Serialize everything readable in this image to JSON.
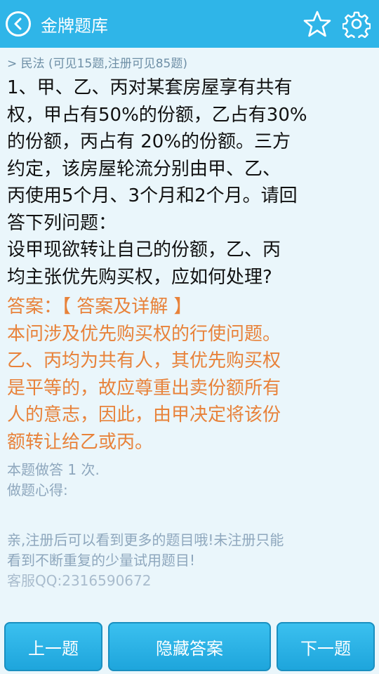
{
  "header": {
    "title": "金牌题库"
  },
  "breadcrumb": "> 民法 (可见15题,注册可见85题)",
  "question": {
    "lines": [
      "1、甲、乙、丙对某套房屋享有共有",
      "权，甲占有50%的份额，乙占有30%",
      "的份额，丙占有 20%的份额。三方",
      "约定，该房屋轮流分别由甲、乙、",
      "丙使用5个月、3个月和2个月。请回",
      "答下列问题：",
      "设甲现欲转让自己的份额，乙、丙",
      "均主张优先购买权，应如何处理?"
    ]
  },
  "answer": {
    "title": "答案：【 答案及详解 】",
    "lines": [
      "本问涉及优先购买权的行使问题。",
      "乙、丙均为共有人，其优先购买权",
      "是平等的，故应尊重出卖份额所有",
      "人的意志，因此，由甲决定将该份",
      "额转让给乙或丙。"
    ]
  },
  "meta": {
    "answered": "本题做答 1 次.",
    "notes_label": "做题心得:"
  },
  "notice": {
    "line1": "亲,注册后可以看到更多的题目哦!未注册只能",
    "line2": "看到不断重复的少量试用题目!",
    "service": "客服QQ:2316590672"
  },
  "buttons": {
    "prev": "上一题",
    "hide_answer": "隐藏答案",
    "next": "下一题"
  },
  "icons": {
    "back": "back-circle-icon",
    "favorite": "star-icon",
    "settings": "gear-icon"
  },
  "colors": {
    "primary": "#2fb5e8",
    "background": "#eaf6fb",
    "answer": "#e8823a",
    "muted": "#8ea7bd"
  }
}
